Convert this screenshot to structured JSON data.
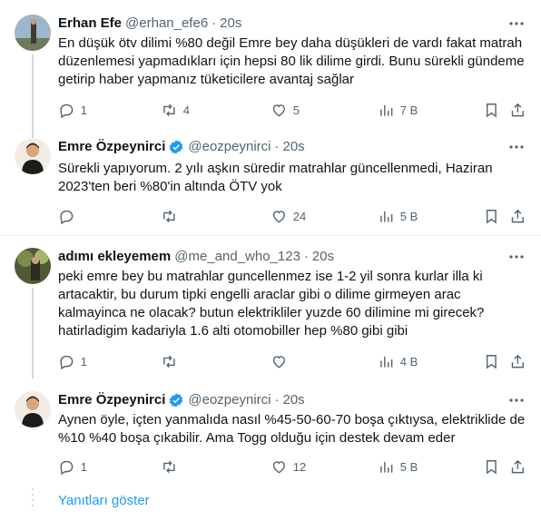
{
  "tweets": [
    {
      "name": "Erhan Efe",
      "handle": "@erhan_efe6",
      "time": "20s",
      "verified": false,
      "text": "En düşük ötv dilimi %80 değil Emre bey daha düşükleri de vardı fakat matrah düzenlemesi yapmadıkları için hepsi 80 lik dilime girdi. Bunu sürekli gündeme getirip haber yapmanız tüketicilere avantaj sağlar",
      "replies": "1",
      "retweets": "4",
      "likes": "5",
      "views": "7 B"
    },
    {
      "name": "Emre Özpeynirci",
      "handle": "@eozpeynirci",
      "time": "20s",
      "verified": true,
      "text": "Sürekli yapıyorum. 2 yılı aşkın süredir matrahlar güncellenmedi, Haziran 2023'ten beri %80'in altında ÖTV yok",
      "replies": "",
      "retweets": "",
      "likes": "24",
      "views": "5 B"
    },
    {
      "name": "adımı ekleyemem",
      "handle": "@me_and_who_123",
      "time": "20s",
      "verified": false,
      "text": "peki emre bey bu matrahlar guncellenmez ise 1-2 yil sonra kurlar illa ki artacaktir, bu durum tipki engelli araclar gibi o dilime girmeyen arac kalmayinca ne olacak? butun elektrikliler yuzde 60 dilimine mi girecek? hatirladigim kadariyla 1.6 alti otomobiller hep %80 gibi gibi",
      "replies": "1",
      "retweets": "",
      "likes": "",
      "views": "4 B"
    },
    {
      "name": "Emre Özpeynirci",
      "handle": "@eozpeynirci",
      "time": "20s",
      "verified": true,
      "text": "Aynen öyle, içten yanmalıda nasıl %45-50-60-70 boşa çıktıysa, elektriklide de %10 %40 boşa çıkabilir. Ama Togg olduğu için destek devam eder",
      "replies": "1",
      "retweets": "",
      "likes": "12",
      "views": "5 B"
    }
  ],
  "show_replies_label": "Yanıtları göster",
  "colors": {
    "accent": "#1d9bf0",
    "text": "#0f1419",
    "secondary": "#536471",
    "border": "#eff3f4"
  }
}
